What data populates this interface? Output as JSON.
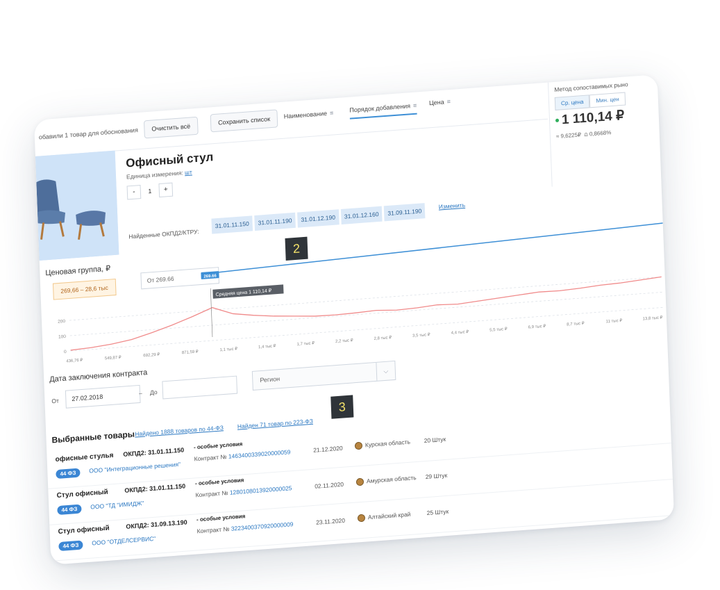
{
  "toolbar": {
    "added_text": "обавили 1 товар для обоснования",
    "clear_all": "Очистить всё",
    "save_list": "Сохранить список",
    "sort_name": "Наименование",
    "sort_order": "Порядок добавления",
    "sort_price": "Цена"
  },
  "right_panel": {
    "method_title": "Метод сопоставимых рыно",
    "tab_avg": "Ср. цена",
    "tab_min": "Мин. цен",
    "price": "1 110,14 ₽",
    "stat_var": "9,6225₽",
    "stat_pct": "0,8668%"
  },
  "product": {
    "title": "Офисный стул",
    "unit_label": "Единица измерения:",
    "unit_value": "шт",
    "qty_minus": "-",
    "qty_value": "1",
    "qty_plus": "+",
    "okpd_label": "Найденные ОКПД2/КТРУ:",
    "okpd_codes": [
      "31.01.11.150",
      "31.01.11.190",
      "31.01.12.190",
      "31.01.12.160",
      "31.09.11.190"
    ],
    "change_link": "Изменить"
  },
  "price_group": {
    "title": "Ценовая группа, ₽",
    "range": "269,66 – 28,6 тыс",
    "from_value": "От 269.66",
    "slider_value": "269.66"
  },
  "chart_data": {
    "type": "line",
    "tooltip": "Средняя цена 1 110,14 ₽",
    "y_ticks": [
      "200",
      "100",
      "0"
    ],
    "x_ticks": [
      "436,76 ₽",
      "549,87 ₽",
      "692,29 ₽",
      "871,59 ₽",
      "1,1 тыс ₽",
      "1,4 тыс ₽",
      "1,7 тыс ₽",
      "2,2 тыс ₽",
      "2,8 тыс ₽",
      "3,5 тыс ₽",
      "4,4 тыс ₽",
      "5,5 тыс ₽",
      "6,9 тыс ₽",
      "8,7 тыс ₽",
      "11 тыс ₽",
      "13,8 тыс ₽"
    ],
    "ylim": [
      0,
      250
    ],
    "values": [
      5,
      12,
      25,
      45,
      80,
      120,
      165,
      215,
      165,
      145,
      130,
      120,
      110,
      108,
      112,
      118,
      110,
      115,
      125,
      120,
      130,
      140,
      150,
      160,
      158,
      165,
      175,
      180,
      190,
      200
    ],
    "line_color": "#f08a8a"
  },
  "date": {
    "title": "Дата заключения контракта",
    "from_label": "От",
    "from_value": "27.02.2018",
    "dash": "–",
    "to_label": "До",
    "to_value": "",
    "region_placeholder": "Регион"
  },
  "markers": {
    "two": "2",
    "three": "3"
  },
  "selected": {
    "title": "Выбранные товары",
    "link_44": "Найдено 1888 товаров по 44-ФЗ",
    "link_223": "Найден 71 товар по 223-ФЗ",
    "items": [
      {
        "name": "офисные стулья",
        "okpd": "ОКПД2: 31.01.11.150",
        "cond": "- особые условия",
        "contract_label": "Контракт №",
        "contract_no": "1463400339020000059",
        "date": "21.12.2020",
        "region": "Курская область",
        "qty": "20 Штук",
        "law": "44 ФЗ",
        "org": "ООО \"Интеграционные решения\""
      },
      {
        "name": "Стул офисный",
        "okpd": "ОКПД2: 31.01.11.150",
        "cond": "- особые условия",
        "contract_label": "Контракт №",
        "contract_no": "1280108013920000025",
        "date": "02.11.2020",
        "region": "Амурская область",
        "qty": "29 Штук",
        "law": "44 ФЗ",
        "org": "ООО \"ТД \"ИМИДЖ\""
      },
      {
        "name": "Стул офисный",
        "okpd": "ОКПД2: 31.09.13.190",
        "cond": "- особые условия",
        "contract_label": "Контракт №",
        "contract_no": "3223400370920000009",
        "date": "23.11.2020",
        "region": "Алтайский край",
        "qty": "25 Штук",
        "law": "44 ФЗ",
        "org": "ООО \"ОТДЕЛСЕРВИС\""
      }
    ]
  }
}
